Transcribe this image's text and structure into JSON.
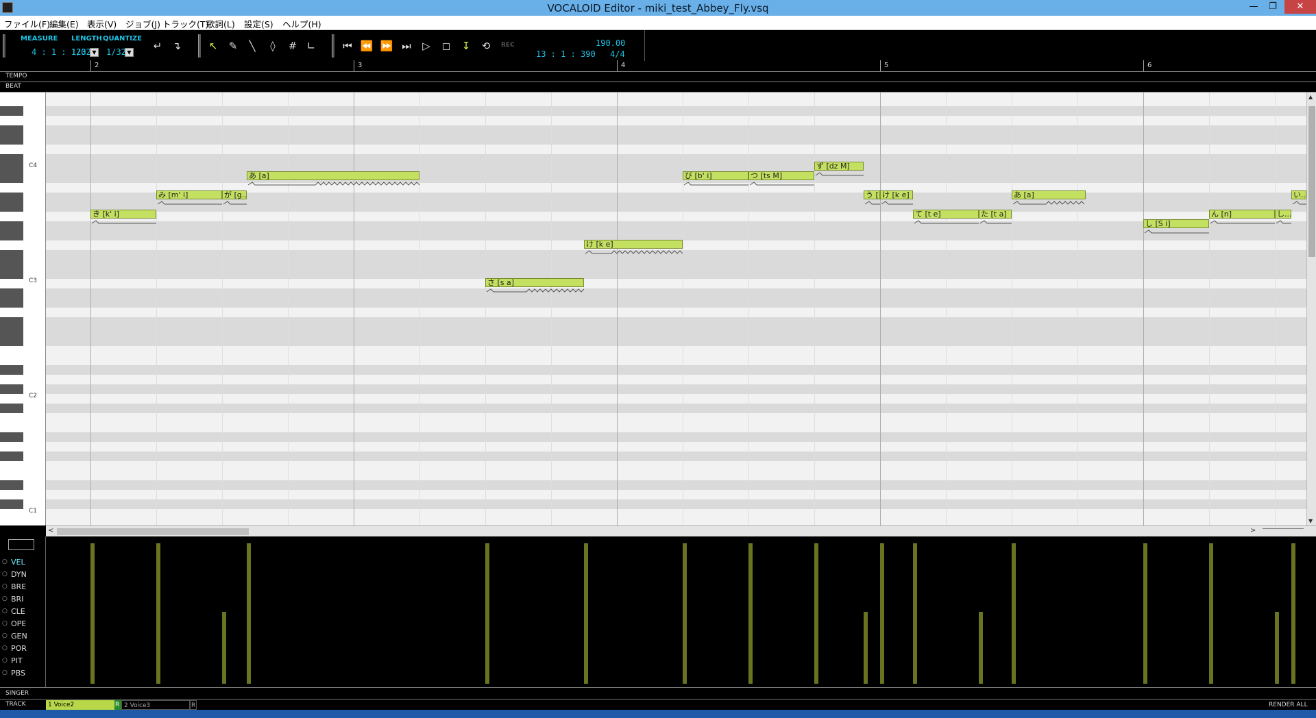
{
  "window": {
    "title": "VOCALOID Editor - miki_test_Abbey_Fly.vsq"
  },
  "menu": [
    "ファイル(F)",
    "編集(E)",
    "表示(V)",
    "ジョブ(J)",
    "トラック(T)",
    "歌詞(L)",
    "設定(S)",
    "ヘルプ(H)"
  ],
  "toolbar": {
    "measure_label": "MEASURE",
    "length_label": "LENGTH",
    "quantize_label": "QUANTIZE",
    "measure_value": "4 : 1 : 120",
    "length_value": "1/32",
    "quantize_value": "1/32",
    "position_value": "13 : 1 : 390",
    "tempo_value": "190.00",
    "signature_value": "4/4",
    "rec_label": "REC"
  },
  "ruler": {
    "tempo_label": "TEMPO",
    "beat_label": "BEAT",
    "measures": [
      "2",
      "3",
      "4",
      "5",
      "6"
    ]
  },
  "keyboard": {
    "octave_labels": [
      "C4",
      "C3",
      "C2",
      "C1"
    ]
  },
  "notes": [
    {
      "lyric": "き [k' i]"
    },
    {
      "lyric": "み [m' i]"
    },
    {
      "lyric": "が [g..."
    },
    {
      "lyric": "あ [a]"
    },
    {
      "lyric": "さ [s a]"
    },
    {
      "lyric": "け [k e]"
    },
    {
      "lyric": "び [b' i]"
    },
    {
      "lyric": "つ [ts M]"
    },
    {
      "lyric": "ず [dz M]"
    },
    {
      "lyric": "う [..."
    },
    {
      "lyric": "け [k e]"
    },
    {
      "lyric": "て [t e]"
    },
    {
      "lyric": "た [t a]"
    },
    {
      "lyric": "あ [a]"
    },
    {
      "lyric": "し [S i]"
    },
    {
      "lyric": "ん [n]"
    },
    {
      "lyric": "し..."
    },
    {
      "lyric": "い..."
    }
  ],
  "controls": [
    "VEL",
    "DYN",
    "BRE",
    "BRI",
    "CLE",
    "OPE",
    "GEN",
    "POR",
    "PIT",
    "PBS"
  ],
  "bottom": {
    "singer_label": "SINGER",
    "track_label": "TRACK",
    "tracks": [
      {
        "name": "1 Voice2",
        "flag": "R"
      },
      {
        "name": "2 Voice3",
        "flag": "R"
      }
    ],
    "render_all": "RENDER ALL"
  },
  "colors": {
    "note_fill": "#c4e060",
    "accent_cyan": "#1ec4e6",
    "titlebar": "#6ab0e8"
  }
}
